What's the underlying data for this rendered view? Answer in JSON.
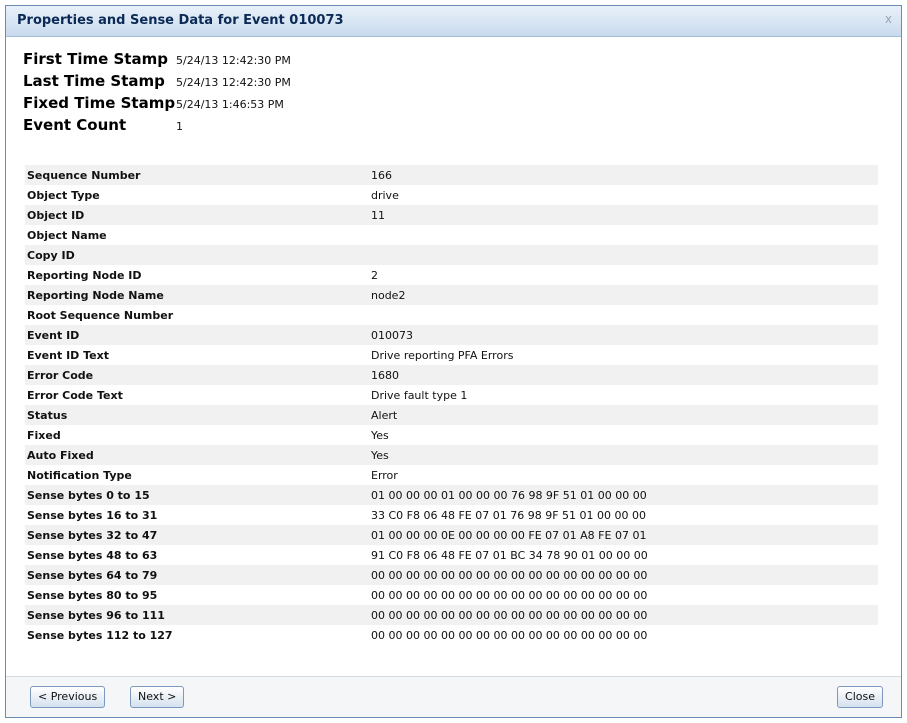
{
  "dialog": {
    "title": "Properties and Sense Data for Event 010073",
    "close_glyph": "x"
  },
  "stamps": [
    {
      "label": "First Time Stamp",
      "value": "5/24/13 12:42:30 PM"
    },
    {
      "label": "Last Time Stamp",
      "value": "5/24/13 12:42:30 PM"
    },
    {
      "label": "Fixed Time Stamp",
      "value": "5/24/13 1:46:53 PM"
    },
    {
      "label": "Event Count",
      "value": "1"
    }
  ],
  "properties": [
    {
      "key": "Sequence Number",
      "value": "166"
    },
    {
      "key": "Object Type",
      "value": "drive"
    },
    {
      "key": "Object ID",
      "value": "11"
    },
    {
      "key": "Object Name",
      "value": ""
    },
    {
      "key": "Copy ID",
      "value": ""
    },
    {
      "key": "Reporting Node ID",
      "value": "2"
    },
    {
      "key": "Reporting Node Name",
      "value": "node2"
    },
    {
      "key": "Root Sequence Number",
      "value": ""
    },
    {
      "key": "Event ID",
      "value": "010073"
    },
    {
      "key": "Event ID Text",
      "value": "Drive reporting PFA Errors"
    },
    {
      "key": "Error Code",
      "value": "1680"
    },
    {
      "key": "Error Code Text",
      "value": "Drive fault type 1"
    },
    {
      "key": "Status",
      "value": "Alert"
    },
    {
      "key": "Fixed",
      "value": "Yes"
    },
    {
      "key": "Auto Fixed",
      "value": "Yes"
    },
    {
      "key": "Notification Type",
      "value": "Error"
    },
    {
      "key": "Sense bytes 0 to 15",
      "value": "01 00 00 00 01 00 00 00 76 98 9F 51 01 00 00 00"
    },
    {
      "key": "Sense bytes 16 to 31",
      "value": "33 C0 F8 06 48 FE 07 01 76 98 9F 51 01 00 00 00"
    },
    {
      "key": "Sense bytes 32 to 47",
      "value": "01 00 00 00 0E 00 00 00 00 FE 07 01 A8 FE 07 01"
    },
    {
      "key": "Sense bytes 48 to 63",
      "value": "91 C0 F8 06 48 FE 07 01 BC 34 78 90 01 00 00 00"
    },
    {
      "key": "Sense bytes 64 to 79",
      "value": "00 00 00 00 00 00 00 00 00 00 00 00 00 00 00 00"
    },
    {
      "key": "Sense bytes 80 to 95",
      "value": "00 00 00 00 00 00 00 00 00 00 00 00 00 00 00 00"
    },
    {
      "key": "Sense bytes 96 to 111",
      "value": "00 00 00 00 00 00 00 00 00 00 00 00 00 00 00 00"
    },
    {
      "key": "Sense bytes 112 to 127",
      "value": "00 00 00 00 00 00 00 00 00 00 00 00 00 00 00 00"
    }
  ],
  "buttons": {
    "previous": "< Previous",
    "next": "Next >",
    "close": "Close"
  }
}
